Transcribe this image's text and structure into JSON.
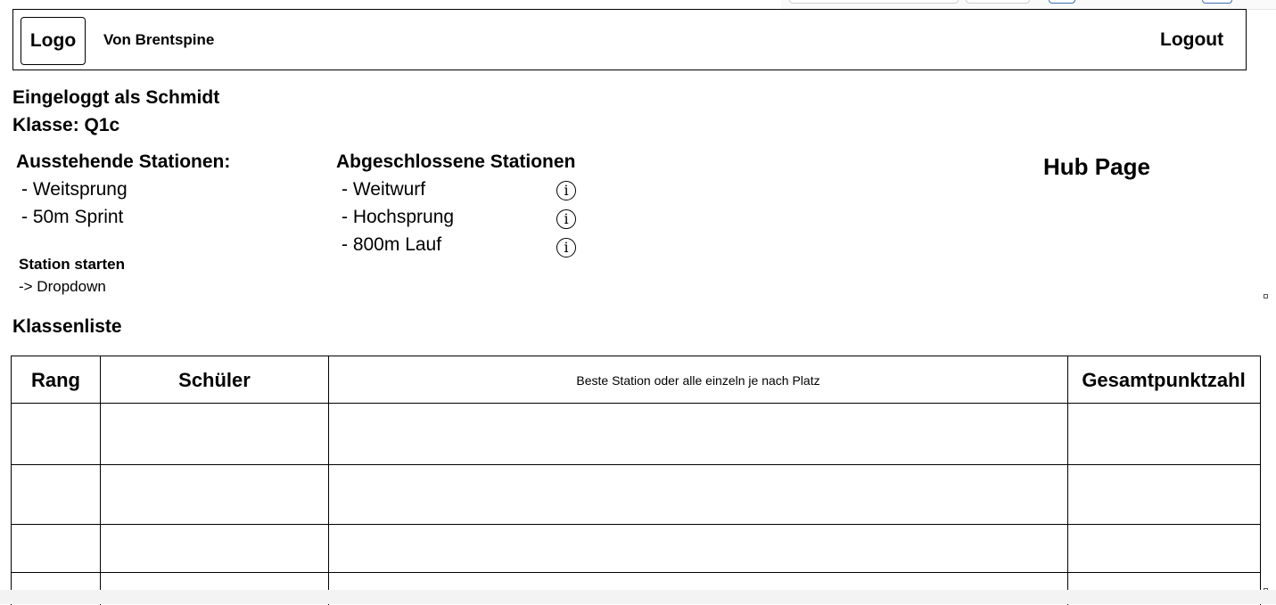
{
  "header": {
    "logo_label": "Logo",
    "brand": "Von Brentspine",
    "logout_label": "Logout"
  },
  "user": {
    "logged_in_as": "Eingeloggt als Schmidt",
    "class_label": "Klasse: Q1c"
  },
  "pending": {
    "title": "Ausstehende Stationen:",
    "items": [
      "- Weitsprung",
      "- 50m Sprint"
    ]
  },
  "completed": {
    "title": "Abgeschlossene Stationen",
    "items": [
      "- Weitwurf",
      "- Hochsprung",
      "- 800m Lauf"
    ],
    "info_glyph": "ⓘ"
  },
  "page_label": "Hub Page",
  "start_station": {
    "title": "Station starten",
    "dropdown_hint": "-> Dropdown"
  },
  "class_list": {
    "title": "Klassenliste",
    "columns": [
      "Rang",
      "Schüler",
      "Beste Station oder alle einzeln je nach Platz",
      "Gesamtpunktzahl"
    ],
    "rows": [
      [
        "",
        "",
        "",
        ""
      ],
      [
        "",
        "",
        "",
        ""
      ],
      [
        "",
        "",
        "",
        ""
      ]
    ]
  }
}
